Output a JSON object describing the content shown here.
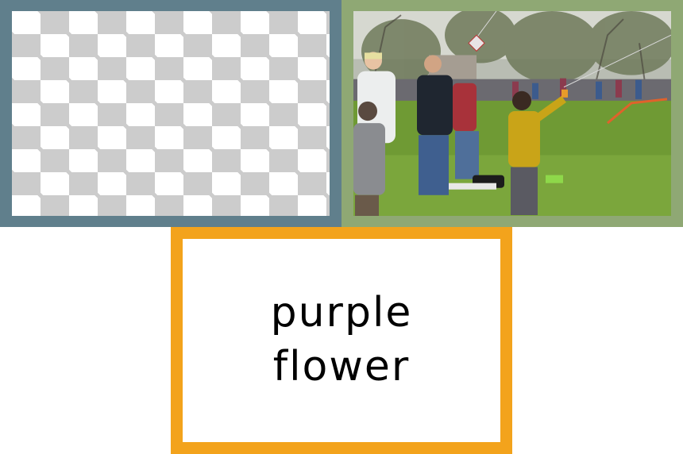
{
  "panels": {
    "checker": {
      "border_color": "#607f8c"
    },
    "photo": {
      "border_color": "#8fa874"
    },
    "text": {
      "border_color": "#f3a31c"
    }
  },
  "card": {
    "line1": "purple",
    "line2": "flower"
  }
}
